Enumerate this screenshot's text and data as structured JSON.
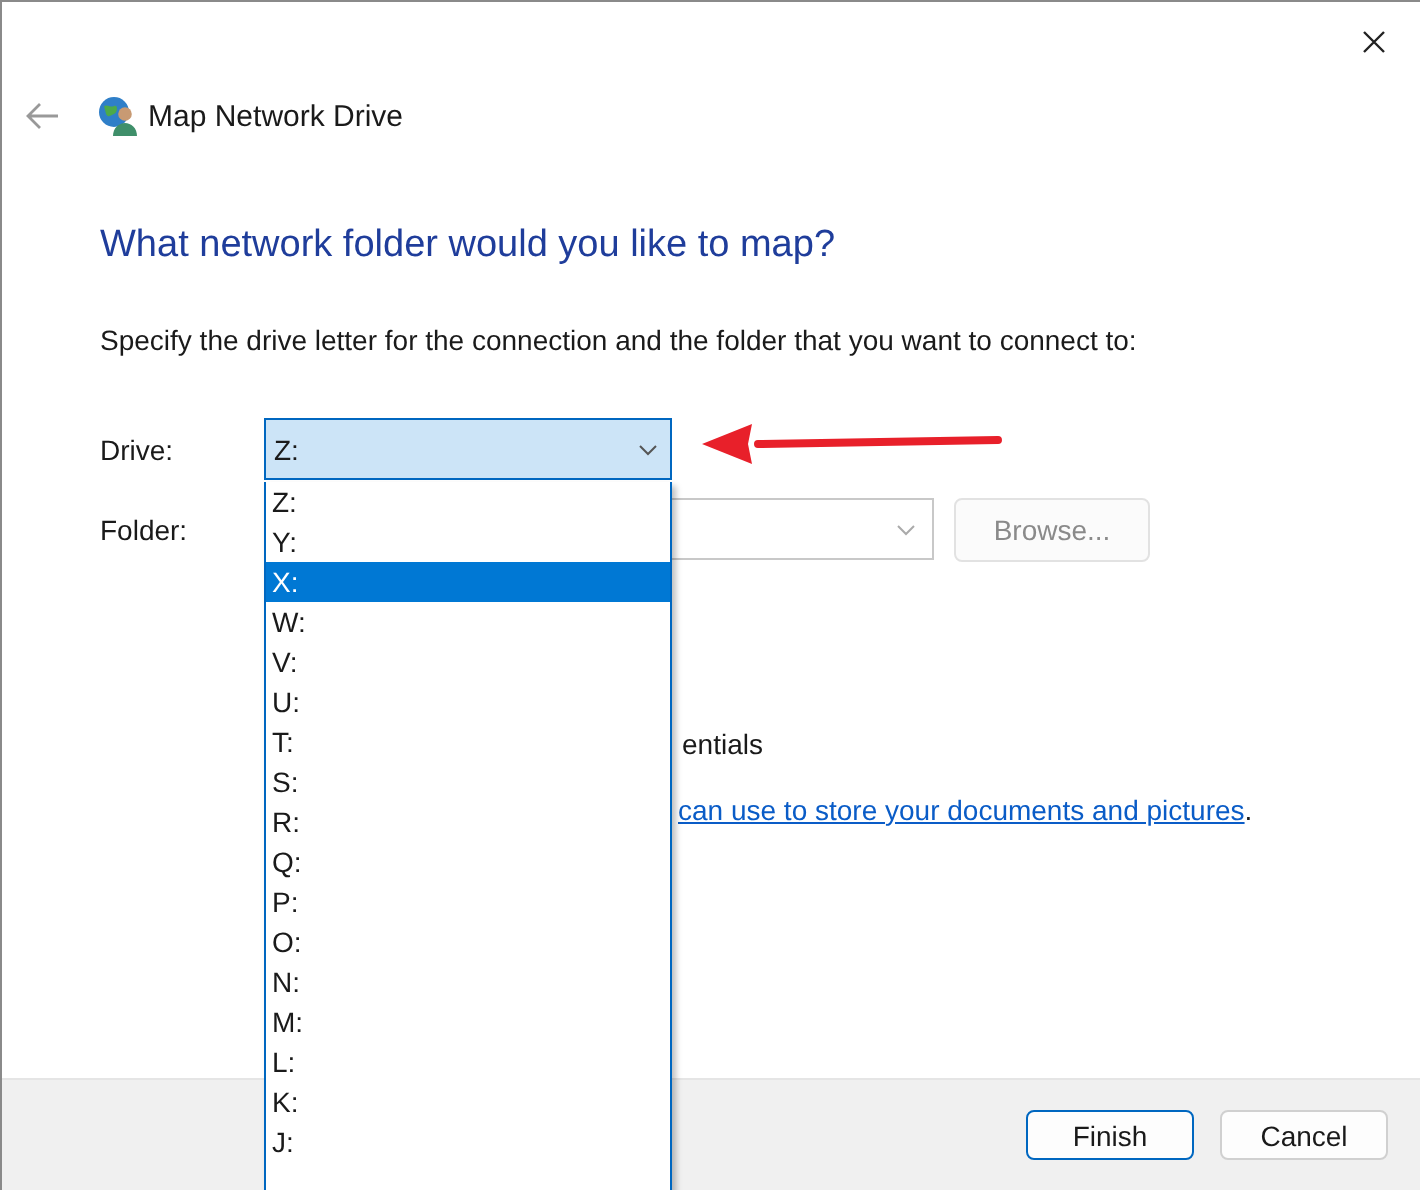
{
  "window": {
    "title": "Map Network Drive"
  },
  "heading": "What network folder would you like to map?",
  "instruction": "Specify the drive letter for the connection and the folder that you want to connect to:",
  "drive": {
    "label": "Drive:",
    "value": "Z:",
    "expanded": true
  },
  "drive_options": [
    {
      "label": "Z:",
      "selected": false
    },
    {
      "label": "Y:",
      "selected": false
    },
    {
      "label": "X:",
      "selected": true
    },
    {
      "label": "W:",
      "selected": false
    },
    {
      "label": "V:",
      "selected": false
    },
    {
      "label": "U:",
      "selected": false
    },
    {
      "label": "T:",
      "selected": false
    },
    {
      "label": "S:",
      "selected": false
    },
    {
      "label": "R:",
      "selected": false
    },
    {
      "label": "Q:",
      "selected": false
    },
    {
      "label": "P:",
      "selected": false
    },
    {
      "label": "O:",
      "selected": false
    },
    {
      "label": "N:",
      "selected": false
    },
    {
      "label": "M:",
      "selected": false
    },
    {
      "label": "L:",
      "selected": false
    },
    {
      "label": "K:",
      "selected": false
    },
    {
      "label": "J:",
      "selected": false
    }
  ],
  "folder": {
    "label": "Folder:"
  },
  "browse_button": {
    "label": "Browse...",
    "disabled": true
  },
  "credentials_text": "entials",
  "link_sentence": {
    "link": "can use to store your documents and pictures",
    "after": "."
  },
  "buttons": [
    {
      "label": "Finish",
      "default": true
    },
    {
      "label": "Cancel",
      "default": false
    }
  ]
}
